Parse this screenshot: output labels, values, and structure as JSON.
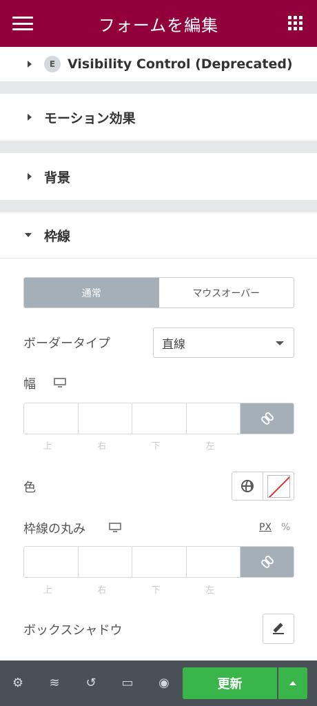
{
  "header": {
    "title": "フォームを編集"
  },
  "sections": {
    "visibility": {
      "badge": "E",
      "label": "Visibility Control (Deprecated)"
    },
    "motion": {
      "label": "モーション効果"
    },
    "background": {
      "label": "背景"
    },
    "border": {
      "label": "枠線"
    }
  },
  "tabs": [
    {
      "label": "通常",
      "active": true
    },
    {
      "label": "マウスオーバー",
      "active": false
    }
  ],
  "border_type": {
    "label": "ボーダータイプ",
    "value": "直線"
  },
  "width": {
    "label": "幅",
    "sub_labels": [
      "上",
      "右",
      "下",
      "左"
    ]
  },
  "color": {
    "label": "色"
  },
  "radius": {
    "label": "枠線の丸み",
    "unit_px": "PX",
    "unit_pct": "%",
    "sub_labels": [
      "上",
      "右",
      "下",
      "左"
    ]
  },
  "box_shadow": {
    "label": "ボックスシャドウ"
  },
  "footer": {
    "update_label": "更新"
  },
  "colors": {
    "brand": "#92003b",
    "update": "#39b54a",
    "footer": "#495157"
  }
}
